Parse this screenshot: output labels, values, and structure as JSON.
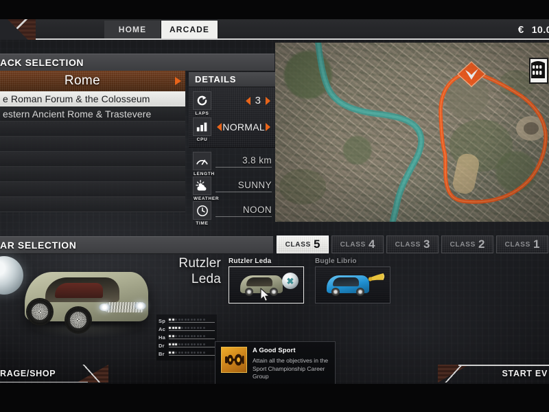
{
  "header": {
    "tabs": [
      {
        "label": "HOME",
        "active": false
      },
      {
        "label": "ARCADE",
        "active": true
      }
    ],
    "wallet": {
      "currency": "€",
      "amount": "10.0"
    }
  },
  "track_selection": {
    "section_title": "ACK SELECTION",
    "current_track": "Rome",
    "routes": [
      {
        "label": "e Roman Forum & the Colosseum",
        "selected": true
      },
      {
        "label": "estern Ancient Rome & Trastevere",
        "selected": false
      },
      {
        "label": "",
        "selected": false
      },
      {
        "label": "",
        "selected": false
      },
      {
        "label": "",
        "selected": false
      },
      {
        "label": "",
        "selected": false
      },
      {
        "label": "",
        "selected": false
      },
      {
        "label": "",
        "selected": false
      }
    ]
  },
  "details": {
    "title": "DETAILS",
    "adjustable": [
      {
        "label": "LAPS",
        "icon": "refresh-icon",
        "value": "3",
        "has_arrows": true,
        "arrow_style": "split"
      },
      {
        "label": "CPU",
        "icon": "bars-icon",
        "value": "NORMAL",
        "has_arrows": true,
        "arrow_style": "tight"
      }
    ],
    "readonly": [
      {
        "label": "LENGTH",
        "icon": "gauge-icon",
        "value": "3.8 km"
      },
      {
        "label": "WEATHER",
        "icon": "sun-cloud-icon",
        "value": "SUNNY"
      },
      {
        "label": "TIME",
        "icon": "clock-icon",
        "value": "NOON"
      }
    ]
  },
  "map": {
    "landmark_badge": "colosseum-icon",
    "route_color": "#f4591a",
    "start_marker": "start-chevron-icon"
  },
  "car_selection": {
    "section_title": "AR SELECTION",
    "classes": [
      {
        "word": "CLASS",
        "number": "5",
        "active": true
      },
      {
        "word": "CLASS",
        "number": "4",
        "active": false
      },
      {
        "word": "CLASS",
        "number": "3",
        "active": false
      },
      {
        "word": "CLASS",
        "number": "2",
        "active": false
      },
      {
        "word": "CLASS",
        "number": "1",
        "active": false
      }
    ],
    "selected_car_title_line1": "Rutzler",
    "selected_car_title_line2": "Leda",
    "thumbnails": [
      {
        "name": "Rutzler Leda",
        "selected": true,
        "badge": "orb-icon",
        "color": "olive"
      },
      {
        "name": "Bugle Librio",
        "selected": false,
        "badge": "horn-icon",
        "color": "blue"
      }
    ],
    "stats": [
      {
        "label": "Sp",
        "filled": 2,
        "total": 12
      },
      {
        "label": "Ac",
        "filled": 4,
        "total": 12
      },
      {
        "label": "Ha",
        "filled": 2,
        "total": 12
      },
      {
        "label": "Dr",
        "filled": 3,
        "total": 12
      },
      {
        "label": "Br",
        "filled": 2,
        "total": 12
      }
    ]
  },
  "achievement_toast": {
    "icon": "dumbbell-icon",
    "title": "A Good Sport",
    "description": "Attain all the objectives in the Sport Championship Career Group"
  },
  "footer": {
    "left_button": "RAGE/SHOP",
    "right_button": "START EV"
  },
  "colors": {
    "accent_orange": "#e8641a",
    "route_orange": "#f4591a",
    "panel_dark": "#1d1e22",
    "highlight_white": "#f0f0ee"
  }
}
